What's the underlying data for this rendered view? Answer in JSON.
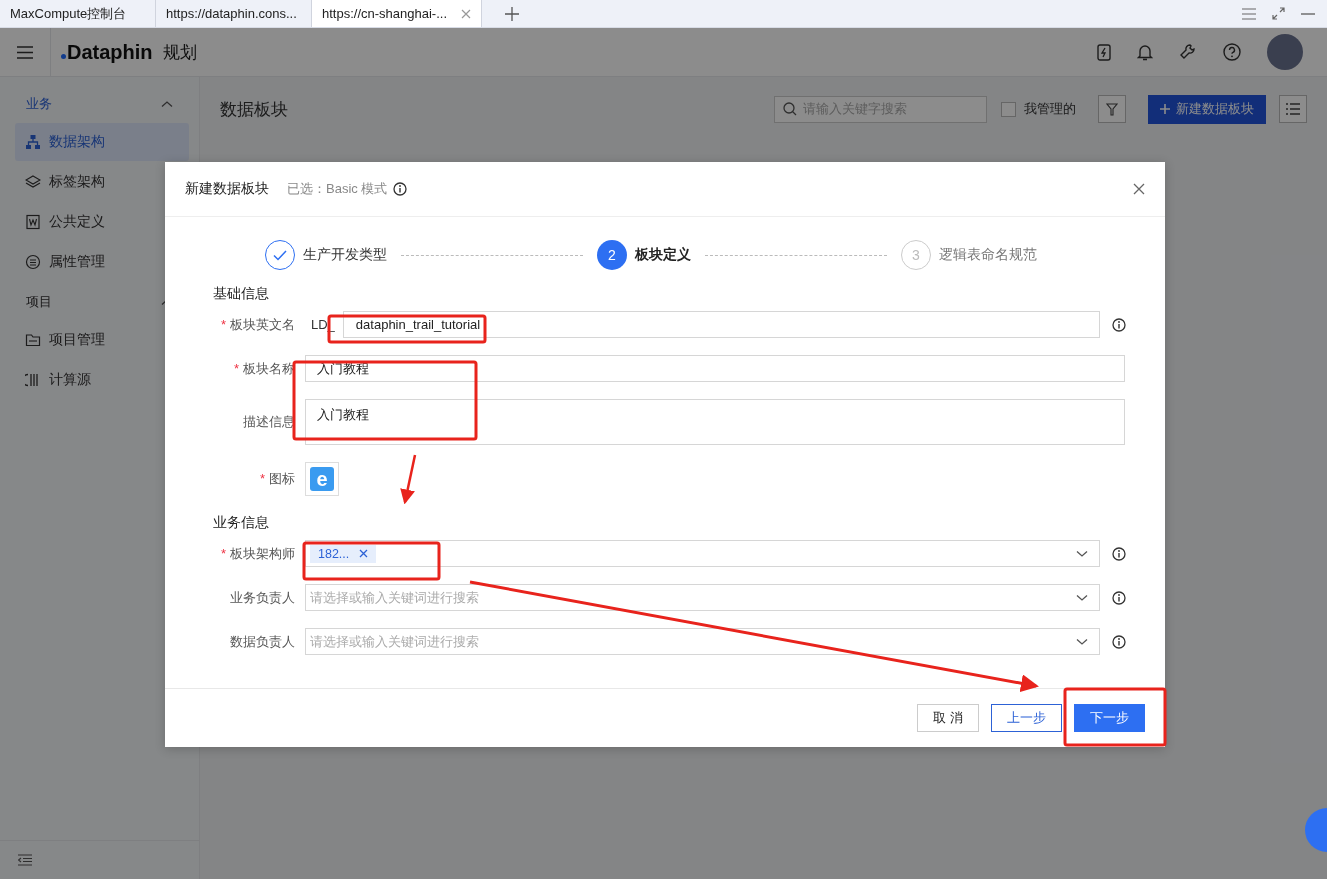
{
  "browser_tabs": [
    {
      "title": "MaxCompute控制台",
      "selected": false
    },
    {
      "title": "https://dataphin.cons...",
      "selected": false
    },
    {
      "title": "https://cn-shanghai-...",
      "selected": true
    }
  ],
  "header": {
    "product": "Dataphin",
    "module": "规划"
  },
  "sidebar": {
    "groups": [
      {
        "label": "业务",
        "expanded": true,
        "items": [
          {
            "label": "数据架构",
            "selected": true
          },
          {
            "label": "标签架构",
            "selected": false
          },
          {
            "label": "公共定义",
            "selected": false
          },
          {
            "label": "属性管理",
            "selected": false
          }
        ]
      },
      {
        "label": "项目",
        "expanded": true,
        "items": [
          {
            "label": "项目管理",
            "selected": false
          },
          {
            "label": "计算源",
            "selected": false
          }
        ]
      }
    ]
  },
  "page": {
    "title": "数据板块",
    "search": {
      "placeholder": "请输入关键字搜索"
    },
    "mine_filter": {
      "label": "我管理的",
      "checked": false
    },
    "new_button": "新建数据板块"
  },
  "modal": {
    "title": "新建数据板块",
    "selected_mode": "已选：Basic 模式",
    "steps": [
      {
        "label": "生产开发类型",
        "completed": true,
        "selected": false
      },
      {
        "number": "2",
        "label": "板块定义",
        "completed": false,
        "selected": true
      },
      {
        "number": "3",
        "label": "逻辑表命名规范",
        "completed": false,
        "selected": false
      }
    ],
    "sections": [
      {
        "title": "基础信息",
        "fields": [
          {
            "kind": "prefixed",
            "label": "板块英文名",
            "required_mark": "*",
            "prefix": "LD_",
            "value": "dataphin_trail_tutorial",
            "info": true
          },
          {
            "kind": "text",
            "label": "板块名称",
            "required_mark": "*",
            "value": "入门教程",
            "info": false
          },
          {
            "kind": "textarea",
            "label": "描述信息",
            "value": "入门教程",
            "info": false
          },
          {
            "kind": "icon",
            "label": "图标",
            "required_mark": "*",
            "value": "e",
            "info": false
          }
        ]
      },
      {
        "title": "业务信息",
        "fields": [
          {
            "kind": "select",
            "label": "板块架构师",
            "required_mark": "*",
            "tags": [
              "182..."
            ],
            "info": true
          },
          {
            "kind": "select",
            "label": "业务负责人",
            "placeholder": "请选择或输入关键词进行搜索",
            "info": true
          },
          {
            "kind": "select",
            "label": "数据负责人",
            "placeholder": "请选择或输入关键词进行搜索",
            "info": true
          }
        ]
      }
    ],
    "buttons": [
      {
        "label": "取消",
        "kind": "default"
      },
      {
        "label": "上一步",
        "kind": "secondary"
      },
      {
        "label": "下一步",
        "kind": "primary"
      }
    ]
  }
}
